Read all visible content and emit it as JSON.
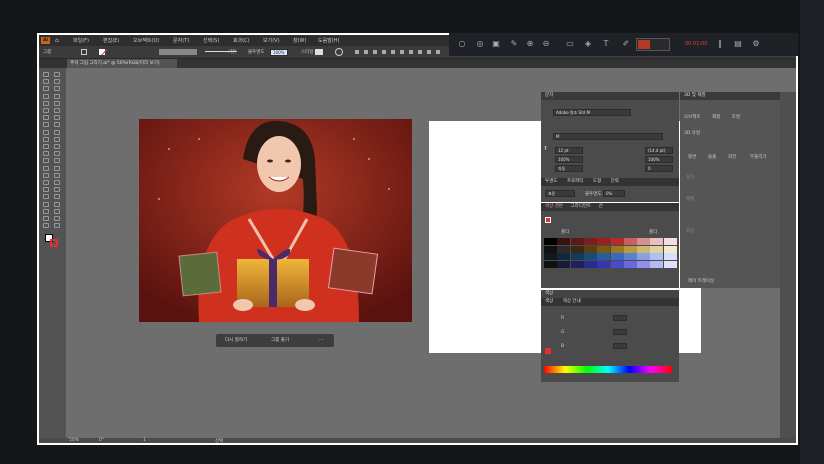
{
  "menubar": {
    "logo": "Ai",
    "items": [
      "파일(F)",
      "편집(E)",
      "오브젝트(O)",
      "문자(T)",
      "선택(S)",
      "효과(C)",
      "보기(V)",
      "창(W)",
      "도움말(H)"
    ]
  },
  "controlbar": {
    "selection_label": "그룹",
    "stroke_label": "기본",
    "opacity_label": "불투명도",
    "opacity_value": "100%",
    "style_label": "스타일"
  },
  "document_tab": "추석 그림 그리기.ai* @ 50%(RGB/미리 보기)",
  "context_bar": {
    "recolor": "다시 칠하기",
    "ungroup": "그룹 풀기",
    "more": "···"
  },
  "char_panel": {
    "title": "문자",
    "font": "Adobe 명조 Std M",
    "style": "M",
    "size": "12 pt",
    "leading": "(14.4 pt)",
    "scale_v": "100%",
    "scale_h": "100%",
    "tracking": "0",
    "kerning": "자동",
    "para_tab": "투명도",
    "para_tab2": "프로퍼티",
    "para_tab3": "도형",
    "para_tab4": "단락",
    "blend_label": "표준",
    "opacity_label": "불투명도",
    "opacity_value": "0%"
  },
  "swatch_panel": {
    "tabs": [
      "색상 견본",
      "그라디언트",
      "선"
    ],
    "label_left": "폴더",
    "label_right": "폴더"
  },
  "color_panel": {
    "tabs": [
      "색상",
      "색상 안내"
    ],
    "header": "색상",
    "r": "R",
    "g": "G",
    "b": "B"
  },
  "side_panel": {
    "title": "3D 및 재질",
    "tabs": [
      "오브젝트",
      "재질",
      "조명"
    ],
    "section": "3D 유형",
    "types": [
      "평면",
      "돌출",
      "회전",
      "부풀리기"
    ],
    "label_a": "깊이",
    "label_b": "베벨",
    "label_c": "회전",
    "footer": "레이 트레이싱"
  },
  "statusbar": {
    "zoom": "50%",
    "angle": "0°",
    "page": "1",
    "tool": "선택"
  },
  "overlay": {
    "timer": "00:01:00"
  },
  "swatch_colors": [
    [
      "#000000",
      "#3b1111",
      "#5a1a1a",
      "#7a1f1f",
      "#9a2020",
      "#b72a2a",
      "#c96060",
      "#d79090",
      "#e8c0c0",
      "#f0e0e0"
    ],
    [
      "#111111",
      "#2a2a2a",
      "#3a2b10",
      "#5a4010",
      "#7a5a10",
      "#9a7a20",
      "#b59a40",
      "#ccb870",
      "#e0d3a0",
      "#f0ead0"
    ],
    [
      "#101820",
      "#12283a",
      "#143a5a",
      "#1a4a7a",
      "#2a5aa0",
      "#3a6ac0",
      "#5a80d0",
      "#8aa0e0",
      "#b0c0f0",
      "#d8e0f8"
    ],
    [
      "#101010",
      "#181838",
      "#202060",
      "#2a2a90",
      "#3535b0",
      "#4a4ad0",
      "#6a6ae0",
      "#9090ea",
      "#b8b8f2",
      "#e0e0fa"
    ]
  ],
  "accent": "#e03030"
}
